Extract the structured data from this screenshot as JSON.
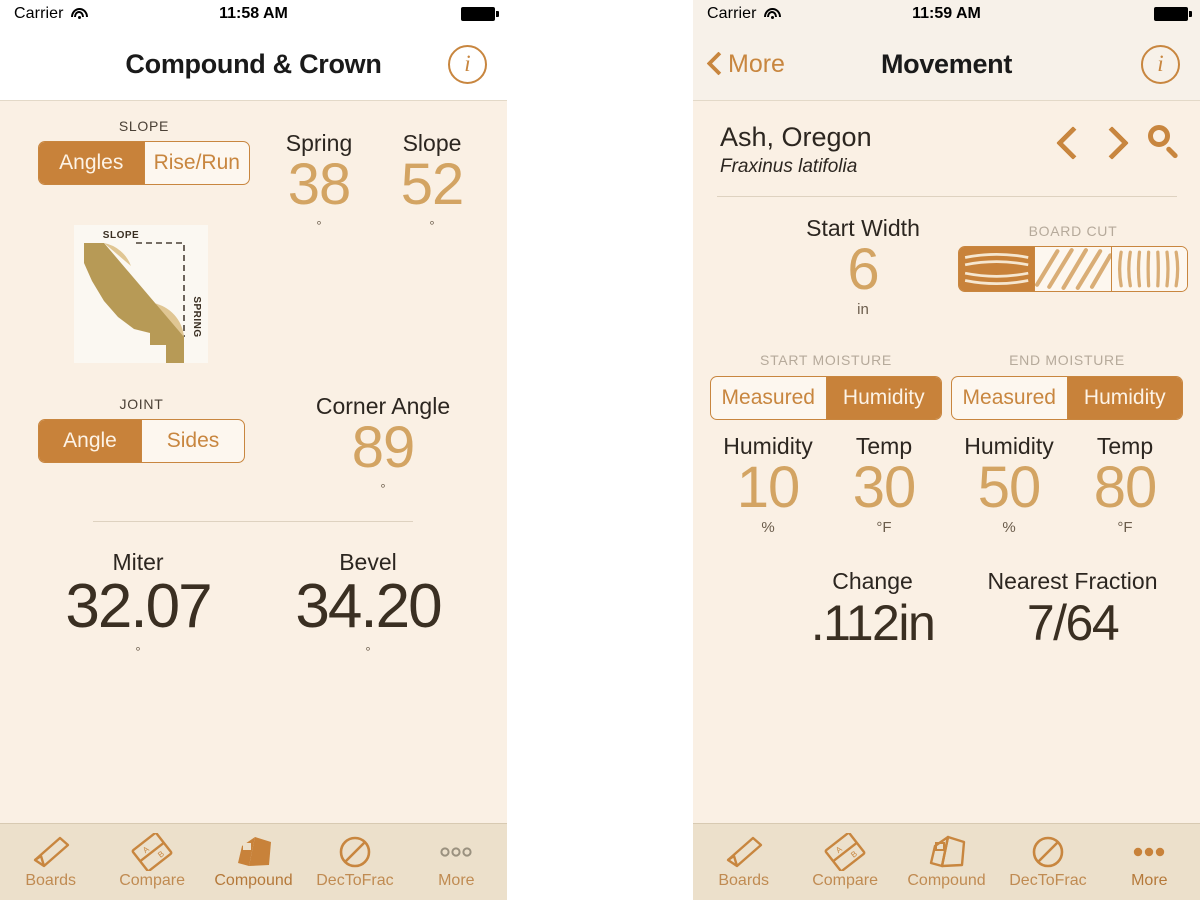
{
  "app": {
    "accent": "#c8823a",
    "accent_light": "#d3a463",
    "background": "#faf0e4",
    "tabbar_bg": "#ece0cb"
  },
  "left": {
    "status": {
      "carrier": "Carrier",
      "time": "11:58 AM",
      "wifi_icon": "wifi-icon",
      "battery_icon": "battery-icon"
    },
    "nav": {
      "title": "Compound & Crown",
      "info_label": "i",
      "info_icon": "info-circle-icon"
    },
    "slope": {
      "group_label": "SLOPE",
      "options": [
        "Angles",
        "Rise/Run"
      ],
      "selected": "Angles"
    },
    "diagram": {
      "name": "crown-molding-diagram",
      "label_top": "SLOPE",
      "label_side": "SPRING"
    },
    "spring": {
      "label": "Spring",
      "value": "38",
      "unit": "°"
    },
    "slope_value": {
      "label": "Slope",
      "value": "52",
      "unit": "°"
    },
    "joint": {
      "group_label": "JOINT",
      "options": [
        "Angle",
        "Sides"
      ],
      "selected": "Angle"
    },
    "corner": {
      "label": "Corner Angle",
      "value": "89",
      "unit": "°"
    },
    "miter": {
      "label": "Miter",
      "value": "32.07",
      "unit": "°"
    },
    "bevel": {
      "label": "Bevel",
      "value": "34.20",
      "unit": "°"
    },
    "tabs": [
      {
        "label": "Boards",
        "icon": "board-icon",
        "selected": false
      },
      {
        "label": "Compare",
        "icon": "compare-icon",
        "selected": false
      },
      {
        "label": "Compound",
        "icon": "compound-icon",
        "selected": true
      },
      {
        "label": "DecToFrac",
        "icon": "dectofrac-icon",
        "selected": false
      },
      {
        "label": "More",
        "icon": "more-dots-icon",
        "selected": false
      }
    ]
  },
  "right": {
    "status": {
      "carrier": "Carrier",
      "time": "11:59 AM",
      "wifi_icon": "wifi-icon",
      "battery_icon": "battery-icon"
    },
    "nav": {
      "back_label": "More",
      "title": "Movement",
      "info_label": "i",
      "info_icon": "info-circle-icon"
    },
    "species": {
      "common_name": "Ash, Oregon",
      "latin_name": "Fraxinus latifolia",
      "prev_icon": "chevron-left-icon",
      "next_icon": "chevron-right-icon",
      "search_icon": "search-icon"
    },
    "start_width": {
      "label": "Start Width",
      "value": "6",
      "unit": "in"
    },
    "board_cut": {
      "group_label": "BOARD CUT",
      "options": [
        "flat-sawn-icon",
        "rift-sawn-icon",
        "quarter-sawn-icon"
      ],
      "selected_index": 0
    },
    "start_moisture": {
      "group_label": "START MOISTURE",
      "options": [
        "Measured",
        "Humidity"
      ],
      "selected": "Humidity",
      "humidity": {
        "label": "Humidity",
        "value": "10",
        "unit": "%"
      },
      "temp": {
        "label": "Temp",
        "value": "30",
        "unit": "°F"
      }
    },
    "end_moisture": {
      "group_label": "END MOISTURE",
      "options": [
        "Measured",
        "Humidity"
      ],
      "selected": "Humidity",
      "humidity": {
        "label": "Humidity",
        "value": "50",
        "unit": "%"
      },
      "temp": {
        "label": "Temp",
        "value": "80",
        "unit": "°F"
      }
    },
    "change": {
      "label": "Change",
      "value": ".112in"
    },
    "nearest_fraction": {
      "label": "Nearest Fraction",
      "value": "7/64"
    },
    "tabs": [
      {
        "label": "Boards",
        "icon": "board-icon",
        "selected": false
      },
      {
        "label": "Compare",
        "icon": "compare-icon",
        "selected": false
      },
      {
        "label": "Compound",
        "icon": "compound-icon",
        "selected": false
      },
      {
        "label": "DecToFrac",
        "icon": "dectofrac-icon",
        "selected": false
      },
      {
        "label": "More",
        "icon": "more-dots-icon",
        "selected": true
      }
    ]
  }
}
